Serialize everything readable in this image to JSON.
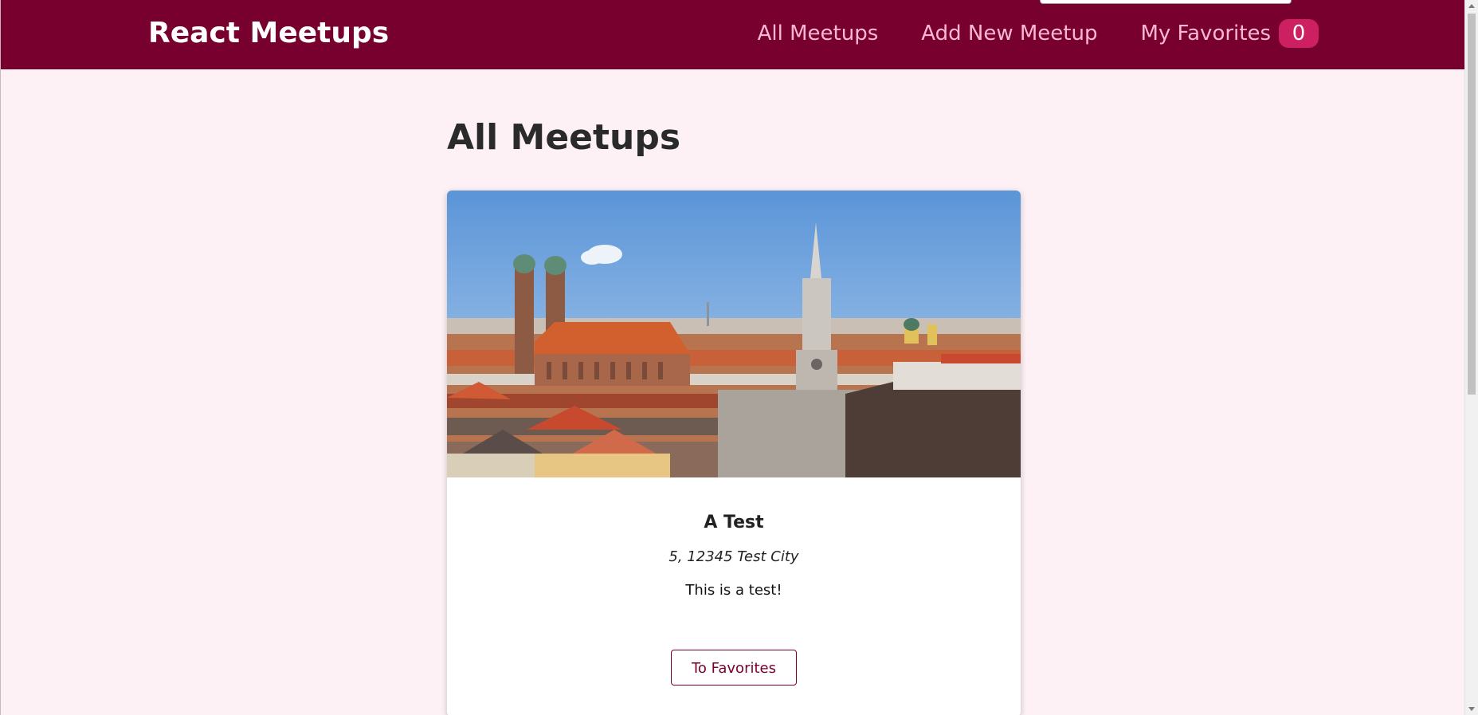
{
  "header": {
    "logo": "React Meetups",
    "nav": {
      "all_meetups": "All Meetups",
      "add_new_meetup": "Add New Meetup",
      "my_favorites": "My Favorites",
      "favorites_count": "0"
    }
  },
  "main": {
    "title": "All Meetups",
    "meetups": [
      {
        "image_alt": "A Test",
        "title": "A Test",
        "address": "5, 12345 Test City",
        "description": "This is a test!",
        "favorite_button": "To Favorites"
      }
    ]
  },
  "colors": {
    "header_bg": "#77002e",
    "nav_link": "#fcb8d2",
    "badge_bg": "#cc2062",
    "page_bg": "#fdf1f5",
    "button_border": "#77002e"
  }
}
